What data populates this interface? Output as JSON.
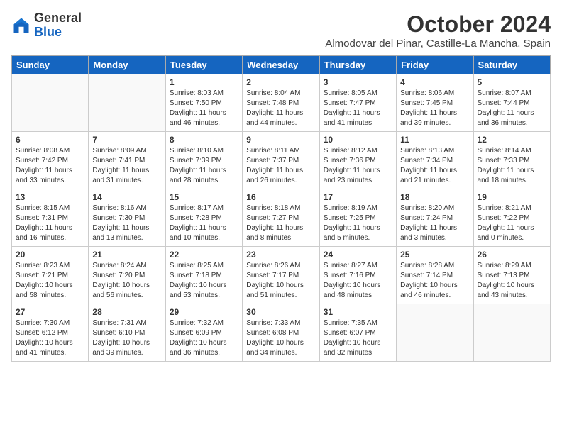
{
  "header": {
    "logo_general": "General",
    "logo_blue": "Blue",
    "month_title": "October 2024",
    "location": "Almodovar del Pinar, Castille-La Mancha, Spain"
  },
  "days_of_week": [
    "Sunday",
    "Monday",
    "Tuesday",
    "Wednesday",
    "Thursday",
    "Friday",
    "Saturday"
  ],
  "weeks": [
    [
      {
        "day": "",
        "content": ""
      },
      {
        "day": "",
        "content": ""
      },
      {
        "day": "1",
        "content": "Sunrise: 8:03 AM\nSunset: 7:50 PM\nDaylight: 11 hours and 46 minutes."
      },
      {
        "day": "2",
        "content": "Sunrise: 8:04 AM\nSunset: 7:48 PM\nDaylight: 11 hours and 44 minutes."
      },
      {
        "day": "3",
        "content": "Sunrise: 8:05 AM\nSunset: 7:47 PM\nDaylight: 11 hours and 41 minutes."
      },
      {
        "day": "4",
        "content": "Sunrise: 8:06 AM\nSunset: 7:45 PM\nDaylight: 11 hours and 39 minutes."
      },
      {
        "day": "5",
        "content": "Sunrise: 8:07 AM\nSunset: 7:44 PM\nDaylight: 11 hours and 36 minutes."
      }
    ],
    [
      {
        "day": "6",
        "content": "Sunrise: 8:08 AM\nSunset: 7:42 PM\nDaylight: 11 hours and 33 minutes."
      },
      {
        "day": "7",
        "content": "Sunrise: 8:09 AM\nSunset: 7:41 PM\nDaylight: 11 hours and 31 minutes."
      },
      {
        "day": "8",
        "content": "Sunrise: 8:10 AM\nSunset: 7:39 PM\nDaylight: 11 hours and 28 minutes."
      },
      {
        "day": "9",
        "content": "Sunrise: 8:11 AM\nSunset: 7:37 PM\nDaylight: 11 hours and 26 minutes."
      },
      {
        "day": "10",
        "content": "Sunrise: 8:12 AM\nSunset: 7:36 PM\nDaylight: 11 hours and 23 minutes."
      },
      {
        "day": "11",
        "content": "Sunrise: 8:13 AM\nSunset: 7:34 PM\nDaylight: 11 hours and 21 minutes."
      },
      {
        "day": "12",
        "content": "Sunrise: 8:14 AM\nSunset: 7:33 PM\nDaylight: 11 hours and 18 minutes."
      }
    ],
    [
      {
        "day": "13",
        "content": "Sunrise: 8:15 AM\nSunset: 7:31 PM\nDaylight: 11 hours and 16 minutes."
      },
      {
        "day": "14",
        "content": "Sunrise: 8:16 AM\nSunset: 7:30 PM\nDaylight: 11 hours and 13 minutes."
      },
      {
        "day": "15",
        "content": "Sunrise: 8:17 AM\nSunset: 7:28 PM\nDaylight: 11 hours and 10 minutes."
      },
      {
        "day": "16",
        "content": "Sunrise: 8:18 AM\nSunset: 7:27 PM\nDaylight: 11 hours and 8 minutes."
      },
      {
        "day": "17",
        "content": "Sunrise: 8:19 AM\nSunset: 7:25 PM\nDaylight: 11 hours and 5 minutes."
      },
      {
        "day": "18",
        "content": "Sunrise: 8:20 AM\nSunset: 7:24 PM\nDaylight: 11 hours and 3 minutes."
      },
      {
        "day": "19",
        "content": "Sunrise: 8:21 AM\nSunset: 7:22 PM\nDaylight: 11 hours and 0 minutes."
      }
    ],
    [
      {
        "day": "20",
        "content": "Sunrise: 8:23 AM\nSunset: 7:21 PM\nDaylight: 10 hours and 58 minutes."
      },
      {
        "day": "21",
        "content": "Sunrise: 8:24 AM\nSunset: 7:20 PM\nDaylight: 10 hours and 56 minutes."
      },
      {
        "day": "22",
        "content": "Sunrise: 8:25 AM\nSunset: 7:18 PM\nDaylight: 10 hours and 53 minutes."
      },
      {
        "day": "23",
        "content": "Sunrise: 8:26 AM\nSunset: 7:17 PM\nDaylight: 10 hours and 51 minutes."
      },
      {
        "day": "24",
        "content": "Sunrise: 8:27 AM\nSunset: 7:16 PM\nDaylight: 10 hours and 48 minutes."
      },
      {
        "day": "25",
        "content": "Sunrise: 8:28 AM\nSunset: 7:14 PM\nDaylight: 10 hours and 46 minutes."
      },
      {
        "day": "26",
        "content": "Sunrise: 8:29 AM\nSunset: 7:13 PM\nDaylight: 10 hours and 43 minutes."
      }
    ],
    [
      {
        "day": "27",
        "content": "Sunrise: 7:30 AM\nSunset: 6:12 PM\nDaylight: 10 hours and 41 minutes."
      },
      {
        "day": "28",
        "content": "Sunrise: 7:31 AM\nSunset: 6:10 PM\nDaylight: 10 hours and 39 minutes."
      },
      {
        "day": "29",
        "content": "Sunrise: 7:32 AM\nSunset: 6:09 PM\nDaylight: 10 hours and 36 minutes."
      },
      {
        "day": "30",
        "content": "Sunrise: 7:33 AM\nSunset: 6:08 PM\nDaylight: 10 hours and 34 minutes."
      },
      {
        "day": "31",
        "content": "Sunrise: 7:35 AM\nSunset: 6:07 PM\nDaylight: 10 hours and 32 minutes."
      },
      {
        "day": "",
        "content": ""
      },
      {
        "day": "",
        "content": ""
      }
    ]
  ]
}
